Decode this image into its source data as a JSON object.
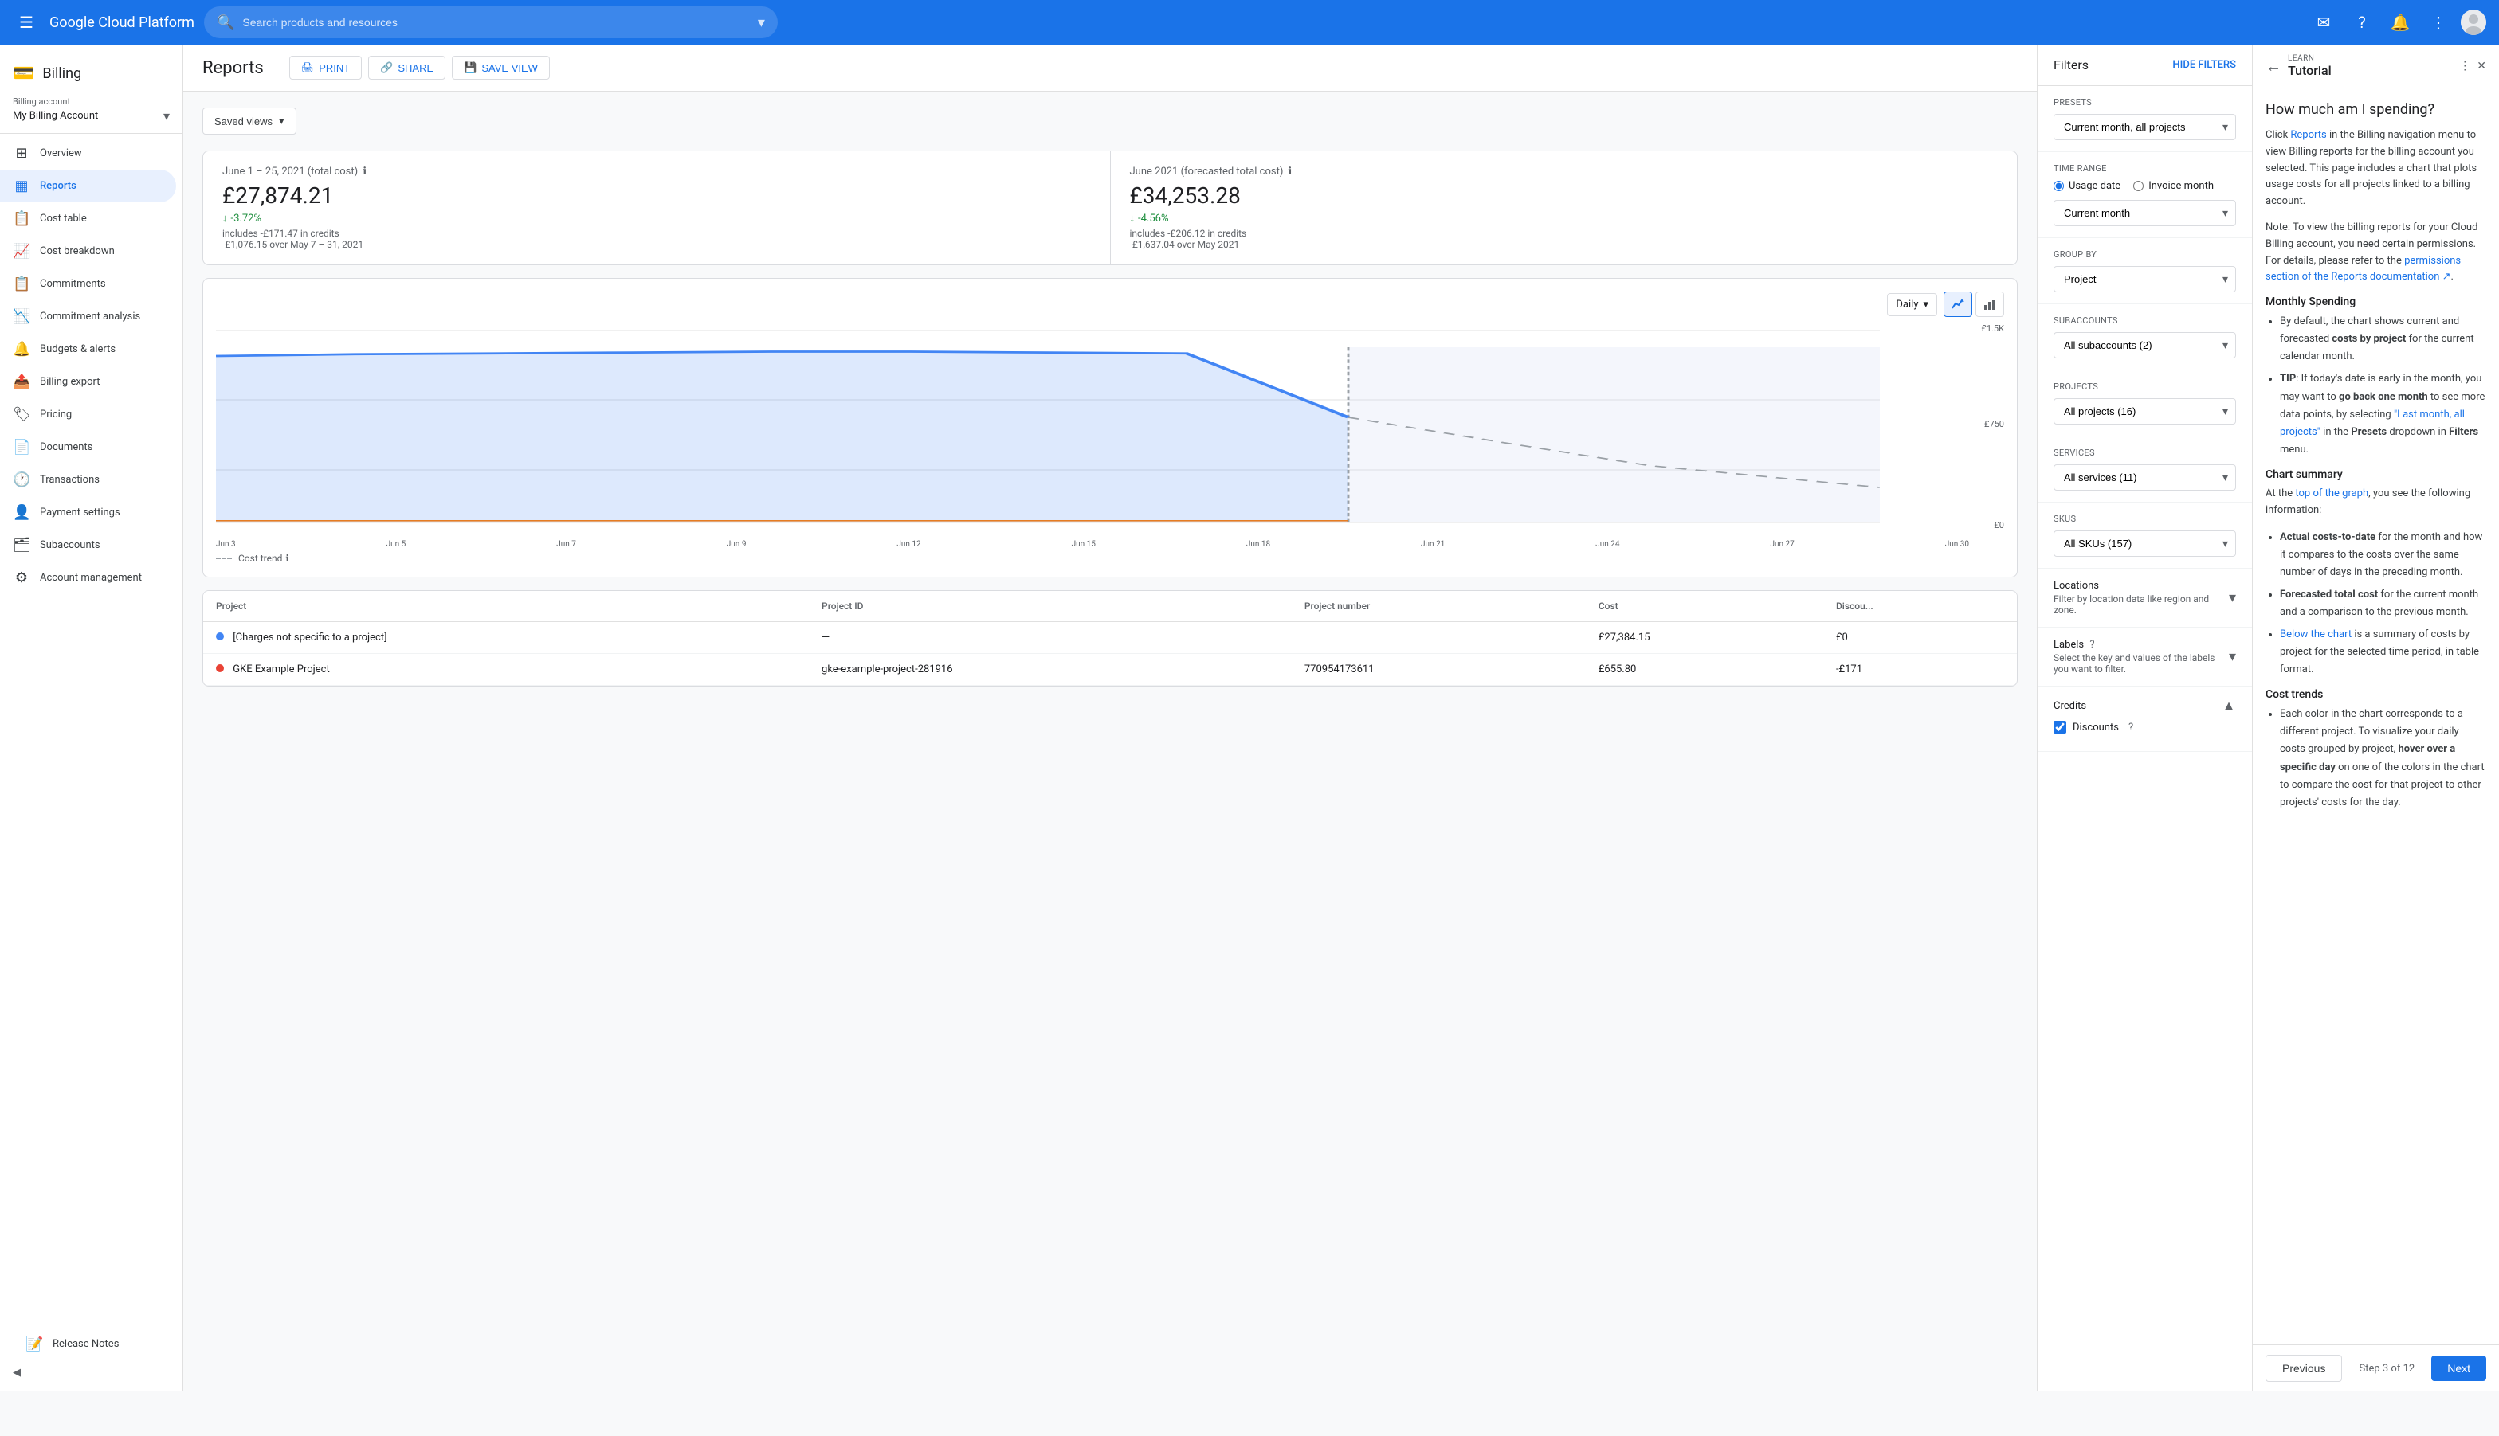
{
  "topNav": {
    "menuIcon": "≡",
    "logo": "Google Cloud Platform",
    "searchPlaceholder": "Search products and resources",
    "dropdownIcon": "▾",
    "icons": [
      "mail",
      "help",
      "bell",
      "more-vert"
    ]
  },
  "sidebar": {
    "billingLabel": "Billing",
    "billingAccountLabel": "Billing account",
    "billingAccountName": "My Billing Account",
    "items": [
      {
        "id": "overview",
        "label": "Overview",
        "icon": "⊞"
      },
      {
        "id": "reports",
        "label": "Reports",
        "icon": "📊",
        "active": true
      },
      {
        "id": "cost-table",
        "label": "Cost table",
        "icon": "📋"
      },
      {
        "id": "cost-breakdown",
        "label": "Cost breakdown",
        "icon": "📈"
      },
      {
        "id": "commitments",
        "label": "Commitments",
        "icon": "📋"
      },
      {
        "id": "commitment-analysis",
        "label": "Commitment analysis",
        "icon": "📉"
      },
      {
        "id": "budgets-alerts",
        "label": "Budgets & alerts",
        "icon": "🔔"
      },
      {
        "id": "billing-export",
        "label": "Billing export",
        "icon": "📤"
      },
      {
        "id": "pricing",
        "label": "Pricing",
        "icon": "🏷"
      },
      {
        "id": "documents",
        "label": "Documents",
        "icon": "📄"
      },
      {
        "id": "transactions",
        "label": "Transactions",
        "icon": "🕐"
      },
      {
        "id": "payment-settings",
        "label": "Payment settings",
        "icon": "👤"
      },
      {
        "id": "subaccounts",
        "label": "Subaccounts",
        "icon": "🗂"
      },
      {
        "id": "account-management",
        "label": "Account management",
        "icon": "⚙"
      }
    ],
    "releaseNotes": "Release Notes",
    "collapseLabel": "◀"
  },
  "pageHeader": {
    "title": "Reports",
    "printLabel": "PRINT",
    "shareLabel": "SHARE",
    "saveViewLabel": "SAVE VIEW"
  },
  "savedViews": {
    "label": "Saved views"
  },
  "summaryCards": [
    {
      "title": "June 1 – 25, 2021 (total cost)",
      "amount": "£27,874.21",
      "change": "-3.72%",
      "sub1": "includes -£171.47 in credits",
      "sub2": "-£1,076.15 over May 7 – 31, 2021"
    },
    {
      "title": "June 2021 (forecasted total cost)",
      "amount": "£34,253.28",
      "change": "-4.56%",
      "sub1": "includes -£206.12 in credits",
      "sub2": "-£1,637.04 over May 2021"
    }
  ],
  "chart": {
    "viewType": "Daily",
    "yLabels": [
      "£1.5K",
      "£750",
      "£0"
    ],
    "xLabels": [
      "Jun 3",
      "Jun 5",
      "Jun 7",
      "Jun 9",
      "Jun 12",
      "Jun 15",
      "Jun 18",
      "Jun 21",
      "Jun 24",
      "Jun 27",
      "Jun 30"
    ],
    "legendLabel": "Cost trend"
  },
  "table": {
    "columns": [
      "Project",
      "Project ID",
      "Project number",
      "Cost",
      "Discounts"
    ],
    "rows": [
      {
        "name": "[Charges not specific to a project]",
        "id": "—",
        "number": "",
        "cost": "£27,384.15",
        "discount": "£0",
        "color": "#4285f4"
      },
      {
        "name": "GKE Example Project",
        "id": "gke-example-project-281916",
        "number": "770954173611",
        "cost": "£655.80",
        "discount": "-£171",
        "color": "#e94235"
      }
    ]
  },
  "filters": {
    "title": "Filters",
    "hideFiltersLabel": "HIDE FILTERS",
    "presetsLabel": "Presets",
    "presetsValue": "Current month, all projects",
    "timeRangeLabel": "Time range",
    "usageDateLabel": "Usage date",
    "invoiceMonthLabel": "Invoice month",
    "currentMonthLabel": "Current month",
    "groupByLabel": "Group by",
    "groupByValue": "Project",
    "subaccountsLabel": "Subaccounts",
    "subaccountsValue": "All subaccounts (2)",
    "projectsLabel": "Projects",
    "projectsValue": "All projects (16)",
    "servicesLabel": "Services",
    "servicesValue": "All services (11)",
    "skusLabel": "SKUs",
    "skusValue": "All SKUs (157)",
    "locationsLabel": "Locations",
    "locationsSubLabel": "Filter by location data like region and zone.",
    "labelsLabel": "Labels",
    "labelsSubLabel": "Select the key and values of the labels you want to filter.",
    "creditsLabel": "Credits",
    "discountsLabel": "Discounts"
  },
  "tutorial": {
    "learnLabel": "LEARN",
    "title": "Tutorial",
    "mainTitle": "How much am I spending?",
    "intro": "Click Reports in the Billing navigation menu to view Billing reports for the billing account you selected. This page includes a chart that plots usage costs for all projects linked to a billing account.",
    "note": "Note: To view the billing reports for your Cloud Billing account, you need certain permissions. For details, please refer to the permissions section of the Reports documentation ↗.",
    "monthlySpendingTitle": "Monthly Spending",
    "monthlySpendingItems": [
      "By default, the chart shows current and forecasted costs by project for the current calendar month.",
      "TIP: If today's date is early in the month, you may want to go back one month to see more data points, by selecting \"Last month, all projects\" in the Presets dropdown in Filters menu."
    ],
    "chartSummaryTitle": "Chart summary",
    "chartSummaryIntro": "At the top of the graph, you see the following information:",
    "chartSummaryItems": [
      "Actual costs-to-date for the month and how it compares to the costs over the same number of days in the preceding month.",
      "Forecasted total cost for the current month and a comparison to the previous month.",
      "Below the chart is a summary of costs by project for the selected time period, in table format."
    ],
    "costTrendsTitle": "Cost trends",
    "costTrendsItems": [
      "Each color in the chart corresponds to a different project. To visualize your daily costs grouped by project, hover over a specific day on one of the colors in the chart to compare the cost for that project to other projects' costs for the day."
    ],
    "prevLabel": "Previous",
    "stepLabel": "Step 3 of 12",
    "nextLabel": "Next"
  }
}
